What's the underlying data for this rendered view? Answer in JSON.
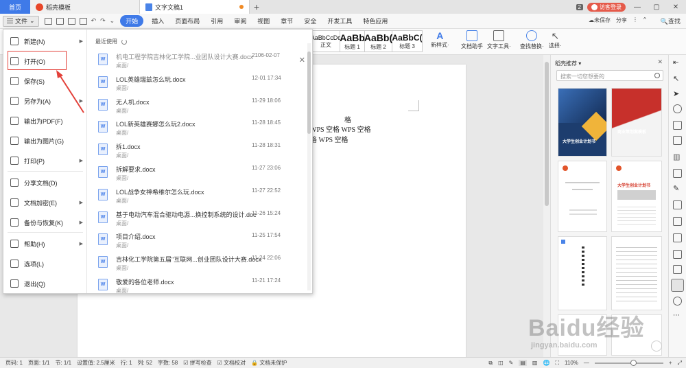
{
  "titlebar": {
    "home_tab": "首页",
    "store_tab": "稻壳模板",
    "doc_tab": "文字文稿1",
    "new_tab_plus": "+",
    "badge_count": "2",
    "login_button": "访客登录",
    "minimize": "—",
    "restore": "▢",
    "close": "✕"
  },
  "menurow": {
    "file_label": "文件",
    "quick_toolbar": [
      "save-icon",
      "print-icon",
      "preview-icon",
      "undo-icon",
      "redo-icon"
    ],
    "tabs": [
      "开始",
      "插入",
      "页面布局",
      "引用",
      "审阅",
      "视图",
      "章节",
      "安全",
      "开发工具",
      "特色应用"
    ],
    "active_tab": "开始",
    "search_label": "查找",
    "cloud_status": "未保存",
    "share_label": "分享"
  },
  "ribbon": {
    "styles": [
      {
        "sample": "AaBbCcDd",
        "name": "正文"
      },
      {
        "sample": "AaBb",
        "name": "标题 1"
      },
      {
        "sample": "AaBb(",
        "name": "标题 2"
      },
      {
        "sample": "AaBbC(",
        "name": "标题 3"
      }
    ],
    "tools": [
      {
        "label": "新样式·",
        "icon": "new-style-icon"
      },
      {
        "label": "文档助手",
        "icon": "doc-assistant-icon"
      },
      {
        "label": "文字工具·",
        "icon": "text-tools-icon"
      },
      {
        "label": "查找替换·",
        "icon": "find-replace-icon"
      },
      {
        "label": "选择·",
        "icon": "select-icon"
      }
    ]
  },
  "file_menu": {
    "items": [
      {
        "label": "新建(N)",
        "icon": "new-file-icon",
        "has_arrow": true
      },
      {
        "label": "打开(O)",
        "icon": "folder-open-icon",
        "has_arrow": false
      },
      {
        "label": "保存(S)",
        "icon": "save-icon",
        "has_arrow": false
      },
      {
        "label": "另存为(A)",
        "icon": "save-as-icon",
        "has_arrow": true
      },
      {
        "label": "输出为PDF(F)",
        "icon": "pdf-icon",
        "has_arrow": false
      },
      {
        "label": "输出为图片(G)",
        "icon": "image-export-icon",
        "has_arrow": false
      },
      {
        "label": "打印(P)",
        "icon": "print-icon",
        "has_arrow": true
      },
      {
        "label": "分享文档(D)",
        "icon": "share-icon",
        "has_arrow": false
      },
      {
        "label": "文档加密(E)",
        "icon": "lock-icon",
        "has_arrow": true
      },
      {
        "label": "备份与恢复(K)",
        "icon": "backup-icon",
        "has_arrow": true
      },
      {
        "label": "帮助(H)",
        "icon": "help-icon",
        "has_arrow": true
      },
      {
        "label": "选项(L)",
        "icon": "gear-icon",
        "has_arrow": false
      },
      {
        "label": "退出(Q)",
        "icon": "exit-icon",
        "has_arrow": false
      }
    ],
    "recent_title": "最近使用",
    "recent_files": [
      {
        "name": "机电工程学院吉林化工学院...业团队设计大赛.docx",
        "path": "桌面/",
        "date": "2106-02-07",
        "dim": true
      },
      {
        "name": "LOL英雄瑞兹怎么玩.docx",
        "path": "桌面/",
        "date": "12-01 17:34",
        "dim": false
      },
      {
        "name": "无人机.docx",
        "path": "桌面/",
        "date": "11-29 18:06",
        "dim": false
      },
      {
        "name": "LOL新英雄赛娜怎么玩2.docx",
        "path": "桌面/",
        "date": "11-28 18:45",
        "dim": false
      },
      {
        "name": "拆1.docx",
        "path": "桌面/",
        "date": "11-28 18:31",
        "dim": false
      },
      {
        "name": "拆解要求.docx",
        "path": "桌面/",
        "date": "11-27 23:06",
        "dim": false
      },
      {
        "name": "LOL战争女神希维尔怎么玩.docx",
        "path": "桌面/",
        "date": "11-27 22:52",
        "dim": false
      },
      {
        "name": "基于电动汽车混合驱动电源...换控制系统的设计.doc",
        "path": "桌面/",
        "date": "11-26 15:24",
        "dim": false
      },
      {
        "name": "项目介绍.docx",
        "path": "桌面/",
        "date": "11-25 17:54",
        "dim": false
      },
      {
        "name": "吉林化工学院第五届\"互联网...创业团队设计大赛.docx",
        "path": "桌面/",
        "date": "11-24 22:06",
        "dim": false
      },
      {
        "name": "敬爱的各位老师.docx",
        "path": "桌面/",
        "date": "11-21 17:24",
        "dim": false
      }
    ]
  },
  "document": {
    "line1": "格",
    "line2": "WPS 空格   WPS 空格",
    "line3": "格   WPS 空格"
  },
  "rec_panel": {
    "title": "稻壳推荐 ▾",
    "search_placeholder": "搜索一切您想要的",
    "card_texts": [
      "大学生创业计划书",
      "商业策划案模板",
      "大学生创业计划书"
    ]
  },
  "statusbar": {
    "page": "页码: 1",
    "pages": "页面: 1/1",
    "section": "节: 1/1",
    "position": "设置值: 2.5厘米",
    "line": "行: 1",
    "column": "列: 52",
    "words": "字数: 58",
    "spellcheck": "拼写检查",
    "proof": "文档校对",
    "protect": "文档未保护",
    "zoom": "110%"
  },
  "watermark": {
    "text": "Baidu经验",
    "sub": "jingyan.baidu.com"
  },
  "colors": {
    "accent": "#3f7ae8",
    "highlight": "#e3413a"
  }
}
